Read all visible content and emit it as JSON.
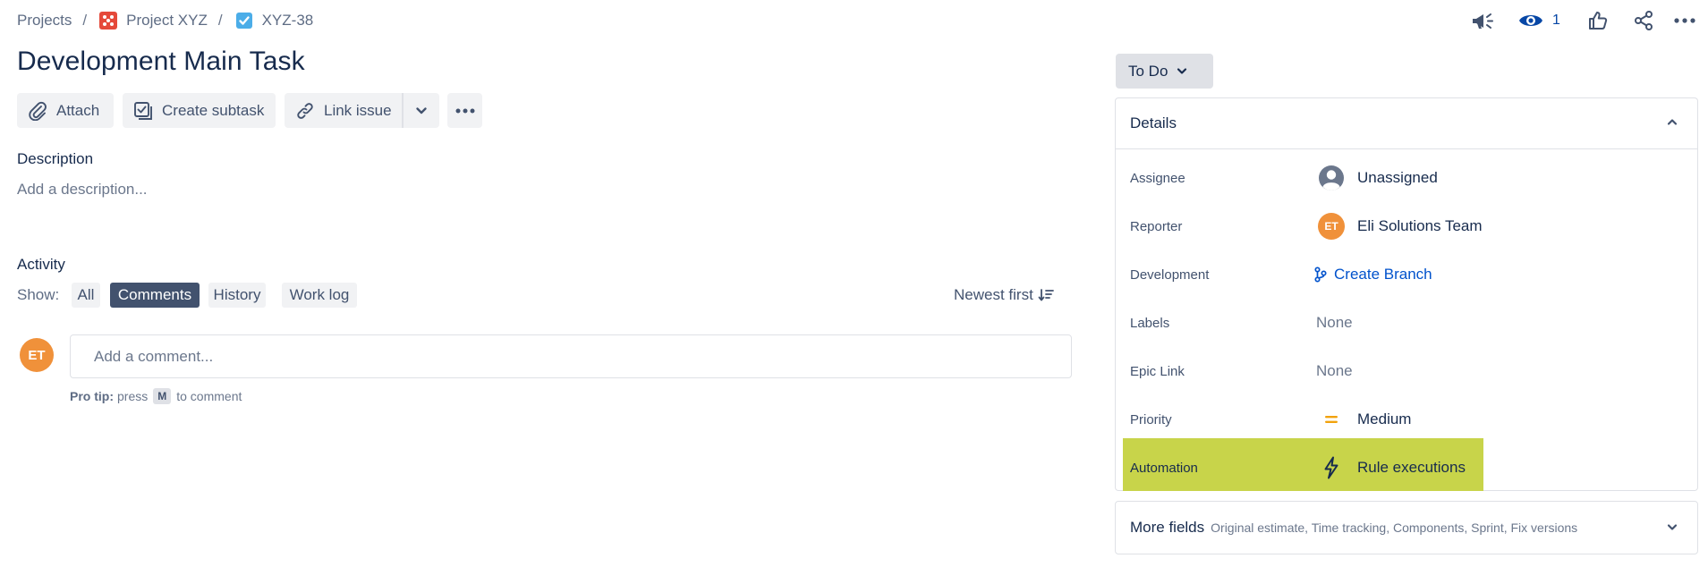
{
  "breadcrumb": {
    "projects": "Projects",
    "separator": "/",
    "project": "Project XYZ",
    "issue_key": "XYZ-38"
  },
  "header": {
    "watch_count": "1",
    "icons": [
      "megaphone-icon",
      "eye-icon",
      "thumbs-up-icon",
      "share-icon",
      "more-icon"
    ]
  },
  "issue": {
    "title": "Development Main Task"
  },
  "toolbar": {
    "attach": "Attach",
    "create_subtask": "Create subtask",
    "link_issue": "Link issue"
  },
  "description": {
    "label": "Description",
    "placeholder": "Add a description..."
  },
  "activity": {
    "label": "Activity",
    "show_label": "Show:",
    "filters": [
      {
        "label": "All",
        "active": false
      },
      {
        "label": "Comments",
        "active": true
      },
      {
        "label": "History",
        "active": false
      },
      {
        "label": "Work log",
        "active": false
      }
    ],
    "sort": "Newest first",
    "comment_placeholder": "Add a comment...",
    "user_initials": "ET",
    "protip_label": "Pro tip:",
    "protip_text_1": "press",
    "protip_key": "M",
    "protip_text_2": "to comment"
  },
  "status": {
    "label": "To Do"
  },
  "details": {
    "title": "Details",
    "rows": [
      {
        "label": "Assignee",
        "value": "Unassigned"
      },
      {
        "label": "Reporter",
        "value": "Eli Solutions Team",
        "initials": "ET"
      },
      {
        "label": "Development",
        "value": "Create Branch"
      },
      {
        "label": "Labels",
        "value": "None"
      },
      {
        "label": "Epic Link",
        "value": "None"
      },
      {
        "label": "Priority",
        "value": "Medium"
      },
      {
        "label": "Automation",
        "value": "Rule executions"
      }
    ]
  },
  "more_fields": {
    "title": "More fields",
    "subtitle": "Original estimate, Time tracking, Components, Sprint, Fix versions"
  },
  "colors": {
    "text": "#172b4d",
    "subtle": "#42526e",
    "link": "#0052cc",
    "avatar": "#f0913a",
    "highlight": "#c8d44a",
    "active_filter": "#42526e",
    "project_icon": "#e5493a",
    "task_icon": "#4bade8"
  }
}
